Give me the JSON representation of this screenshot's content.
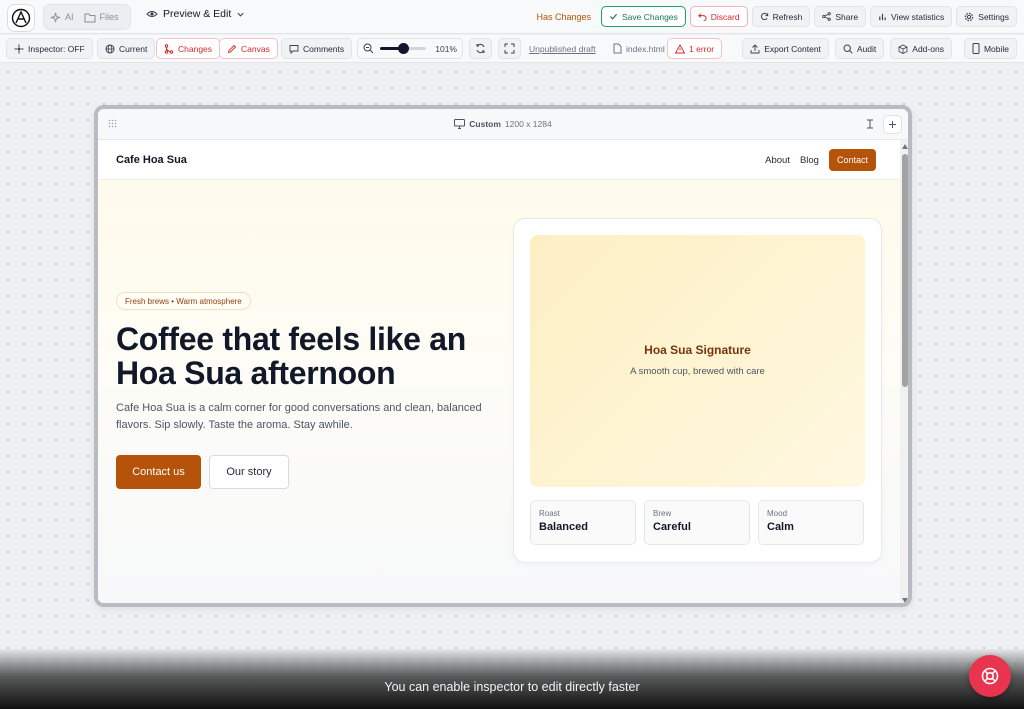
{
  "topbar": {
    "seg_ai": "AI",
    "seg_files": "Files",
    "mode_label": "Preview & Edit",
    "has_changes": "Has Changes",
    "save": "Save Changes",
    "discard": "Discard",
    "refresh": "Refresh",
    "share": "Share",
    "view_statistics": "View statistics",
    "settings": "Settings"
  },
  "toolbar": {
    "inspector": "Inspector: OFF",
    "current": "Current",
    "changes": "Changes",
    "canvas": "Canvas",
    "comments": "Comments",
    "zoom_value": "101%",
    "zoom_fraction": 0.5,
    "draft": "Unpublished draft",
    "file": "index.html",
    "errors": "1 error",
    "export": "Export Content",
    "audit": "Audit",
    "addons": "Add-ons",
    "mobile": "Mobile"
  },
  "frame": {
    "size_label": "Custom",
    "size_value": "1200 x 1284"
  },
  "site": {
    "brand": "Cafe Hoa Sua",
    "nav": {
      "about": "About",
      "blog": "Blog",
      "contact": "Contact"
    },
    "pill": "Fresh brews • Warm atmosphere",
    "headline": "Coffee that feels like an Hoa Sua afternoon",
    "paragraph": "Cafe Hoa Sua is a calm corner for good conversations and clean, balanced flavors. Sip slowly. Taste the aroma. Stay awhile.",
    "cta_primary": "Contact us",
    "cta_secondary": "Our story",
    "card": {
      "title": "Hoa Sua Signature",
      "subtitle": "A smooth cup, brewed with care",
      "stats": [
        {
          "label": "Roast",
          "value": "Balanced"
        },
        {
          "label": "Brew",
          "value": "Careful"
        },
        {
          "label": "Mood",
          "value": "Calm"
        }
      ]
    }
  },
  "hint": "You can enable inspector to edit directly faster",
  "colors": {
    "accent": "#b45309",
    "save_green": "#16794c",
    "danger": "#dc2626",
    "help_button": "#e8344e"
  },
  "icons": [
    "app-logo-icon",
    "sparkle-icon",
    "folder-icon",
    "eye-icon",
    "chevron-down-icon",
    "check-icon",
    "undo-icon",
    "refresh-icon",
    "share-icon",
    "bar-chart-icon",
    "gear-icon",
    "crosshair-icon",
    "globe-icon",
    "git-branch-icon",
    "pen-icon",
    "comment-icon",
    "zoom-out-icon",
    "sync-icon",
    "fullscreen-icon",
    "file-icon",
    "warning-icon",
    "export-icon",
    "search-icon",
    "package-icon",
    "mobile-icon",
    "monitor-icon",
    "drag-handle-icon",
    "resize-icon",
    "plus-icon",
    "lifebuoy-icon"
  ]
}
